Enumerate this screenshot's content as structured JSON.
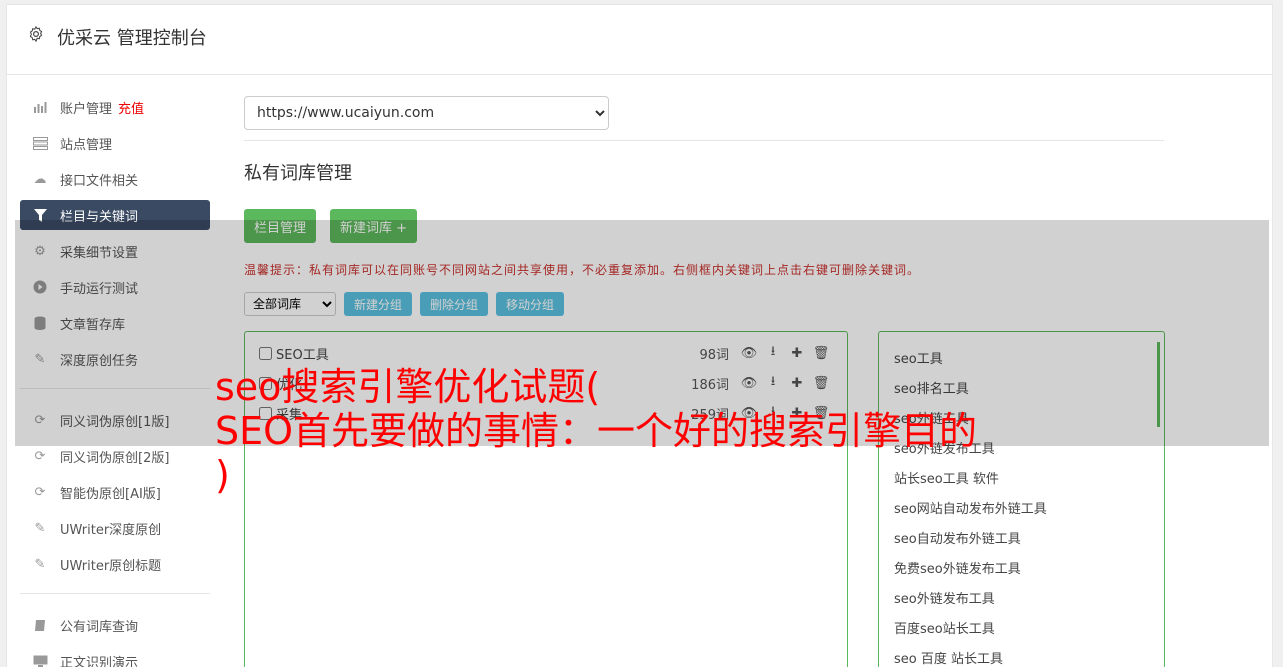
{
  "header": {
    "title": "优采云 管理控制台",
    "icon": "gear-icon"
  },
  "sidebar": {
    "items": [
      {
        "label": "账户管理",
        "badge": "充值",
        "icon": "bar-chart-icon"
      },
      {
        "label": "站点管理",
        "icon": "server-icon"
      },
      {
        "label": "接口文件相关",
        "icon": "cloud-upload-icon"
      },
      {
        "label": "栏目与关键词",
        "icon": "filter-icon",
        "active": true
      },
      {
        "label": "采集细节设置",
        "icon": "cogs-icon"
      },
      {
        "label": "手动运行测试",
        "icon": "play-icon"
      },
      {
        "label": "文章暂存库",
        "icon": "database-icon"
      },
      {
        "label": "深度原创任务",
        "icon": "edit-icon"
      }
    ],
    "items2": [
      {
        "label": "同义词伪原创[1版]",
        "icon": "refresh-icon"
      },
      {
        "label": "同义词伪原创[2版]",
        "icon": "refresh-icon"
      },
      {
        "label": "智能伪原创[AI版]",
        "icon": "refresh-icon"
      },
      {
        "label": "UWriter深度原创",
        "icon": "edit-icon"
      },
      {
        "label": "UWriter原创标题",
        "icon": "edit-icon"
      }
    ],
    "items3": [
      {
        "label": "公有词库查询",
        "icon": "book-icon"
      },
      {
        "label": "正文识别演示",
        "icon": "monitor-icon"
      }
    ]
  },
  "main": {
    "site_select": "https://www.ucaiyun.com",
    "page_title": "私有词库管理",
    "btn_column": "栏目管理",
    "btn_new_lib": "新建词库 +",
    "tip": "温馨提示：私有词库可以在同账号不同网站之间共享使用，不必重复添加。右侧框内关键词上点击右键可删除关键词。",
    "group_select": "全部词库",
    "btn_new_group": "新建分组",
    "btn_del_group": "删除分组",
    "btn_move_group": "移动分组"
  },
  "libraries": [
    {
      "name": "SEO工具",
      "count": "98词"
    },
    {
      "name": "优化",
      "count": "186词"
    },
    {
      "name": "采集",
      "count": "259词"
    }
  ],
  "keywords": [
    "seo工具",
    "seo排名工具",
    "seo外链工具",
    "seo外链发布工具",
    "站长seo工具 软件",
    "seo网站自动发布外链工具",
    "seo自动发布外链工具",
    "免费seo外链发布工具",
    "seo外链发布工具",
    "百度seo站长工具",
    "seo 百度 站长工具"
  ],
  "overlay_headline": "seo搜索引擎优化试题(\nSEO首先要做的事情：一个好的搜索引擎目的\n)",
  "colors": {
    "active_nav": "#3a4a63",
    "green": "#5cb85c",
    "blue": "#5bc0de",
    "headline": "#ff0000"
  }
}
